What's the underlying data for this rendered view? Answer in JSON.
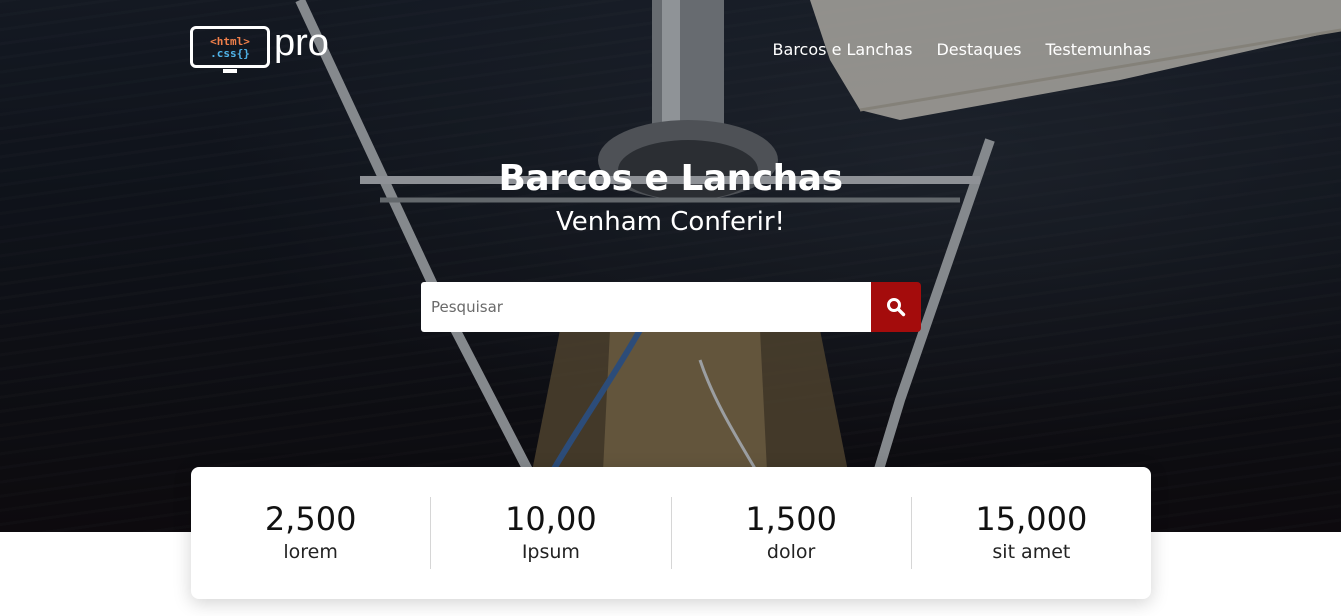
{
  "header": {
    "logo": {
      "line1": "<html>",
      "line2": ".css{}",
      "wordmark": "pro"
    },
    "nav": [
      {
        "label": "Barcos e Lanchas"
      },
      {
        "label": "Destaques"
      },
      {
        "label": "Testemunhas"
      }
    ]
  },
  "hero": {
    "title": "Barcos e Lanchas",
    "subtitle": "Venham Conferir!",
    "search": {
      "placeholder": "Pesquisar",
      "value": "",
      "button_icon": "search-icon"
    }
  },
  "stats": [
    {
      "value": "2,500",
      "label": "lorem"
    },
    {
      "value": "10,00",
      "label": "Ipsum"
    },
    {
      "value": "1,500",
      "label": "dolor"
    },
    {
      "value": "15,000",
      "label": "sit amet"
    }
  ],
  "colors": {
    "accent": "#a40c0c",
    "logo_html": "#f07f4a",
    "logo_css": "#4fb3e8",
    "hero_bg": "#151a24"
  }
}
